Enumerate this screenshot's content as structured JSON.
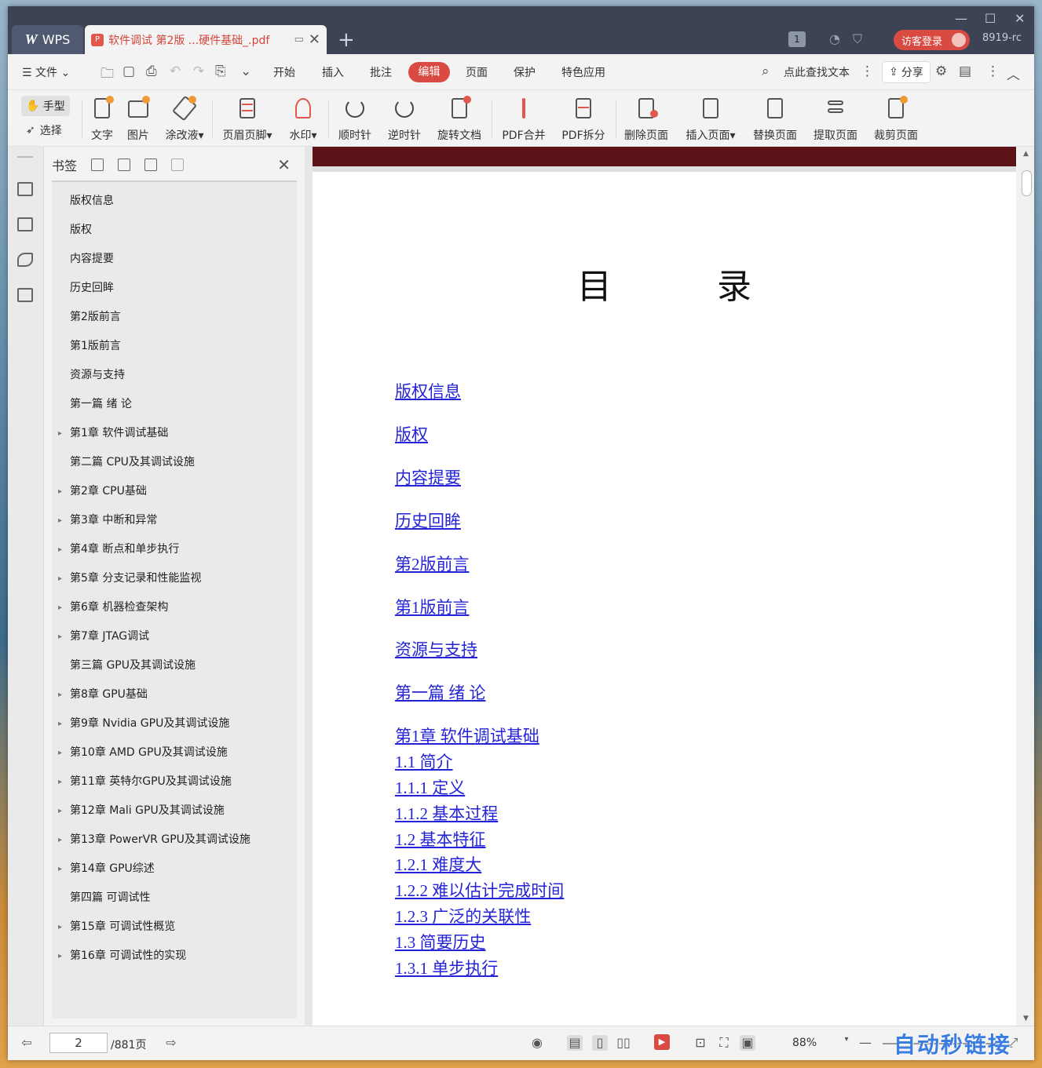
{
  "titlebar": {
    "app_tab": "WPS",
    "doc_tab": "软件调试 第2版 ...硬件基础_.pdf",
    "badge": "1",
    "login_label": "访客登录",
    "user": "8919-rc"
  },
  "menu": {
    "file": "文件",
    "items": [
      "开始",
      "插入",
      "批注",
      "编辑",
      "页面",
      "保护",
      "特色应用"
    ],
    "active": "编辑",
    "search_placeholder": "点此查找文本",
    "share": "分享"
  },
  "ribbon": {
    "hand": "手型",
    "select": "选择",
    "buttons": [
      "文字",
      "图片",
      "涂改液",
      "页眉页脚",
      "水印",
      "顺时针",
      "逆时针",
      "旋转文档",
      "PDF合并",
      "PDF拆分",
      "删除页面",
      "插入页面",
      "替换页面",
      "提取页面",
      "裁剪页面"
    ]
  },
  "bookmarks": {
    "title": "书签",
    "items": [
      {
        "label": "版权信息",
        "expandable": false
      },
      {
        "label": "版权",
        "expandable": false
      },
      {
        "label": "内容提要",
        "expandable": false
      },
      {
        "label": "历史回眸",
        "expandable": false
      },
      {
        "label": "第2版前言",
        "expandable": false
      },
      {
        "label": "第1版前言",
        "expandable": false
      },
      {
        "label": "资源与支持",
        "expandable": false
      },
      {
        "label": "第一篇 绪 论",
        "expandable": false
      },
      {
        "label": "第1章 软件调试基础",
        "expandable": true
      },
      {
        "label": "第二篇 CPU及其调试设施",
        "expandable": false
      },
      {
        "label": "第2章 CPU基础",
        "expandable": true
      },
      {
        "label": "第3章 中断和异常",
        "expandable": true
      },
      {
        "label": "第4章 断点和单步执行",
        "expandable": true
      },
      {
        "label": "第5章 分支记录和性能监视",
        "expandable": true
      },
      {
        "label": "第6章 机器检查架构",
        "expandable": true
      },
      {
        "label": "第7章 JTAG调试",
        "expandable": true
      },
      {
        "label": "第三篇 GPU及其调试设施",
        "expandable": false
      },
      {
        "label": "第8章 GPU基础",
        "expandable": true
      },
      {
        "label": "第9章 Nvidia GPU及其调试设施",
        "expandable": true
      },
      {
        "label": "第10章 AMD GPU及其调试设施",
        "expandable": true
      },
      {
        "label": "第11章 英特尔GPU及其调试设施",
        "expandable": true
      },
      {
        "label": "第12章 Mali GPU及其调试设施",
        "expandable": true
      },
      {
        "label": "第13章 PowerVR GPU及其调试设施",
        "expandable": true
      },
      {
        "label": "第14章 GPU综述",
        "expandable": true
      },
      {
        "label": "第四篇 可调试性",
        "expandable": false
      },
      {
        "label": "第15章 可调试性概览",
        "expandable": true
      },
      {
        "label": "第16章 可调试性的实现",
        "expandable": true
      }
    ]
  },
  "document": {
    "heading": "目 录",
    "toc": [
      "版权信息",
      "版权",
      "内容提要",
      "历史回眸",
      "第2版前言",
      "第1版前言",
      "资源与支持",
      "第一篇 绪 论",
      "第1章 软件调试基础",
      "1.1 简介",
      "1.1.1 定义",
      "1.1.2 基本过程",
      "1.2 基本特征",
      "1.2.1 难度大",
      "1.2.2 难以估计完成时间",
      "1.2.3 广泛的关联性",
      "1.3 简要历史",
      "1.3.1 单步执行"
    ]
  },
  "status": {
    "page": "2",
    "total": "/881页",
    "zoom": "88%"
  },
  "watermark": "自动秒链接"
}
